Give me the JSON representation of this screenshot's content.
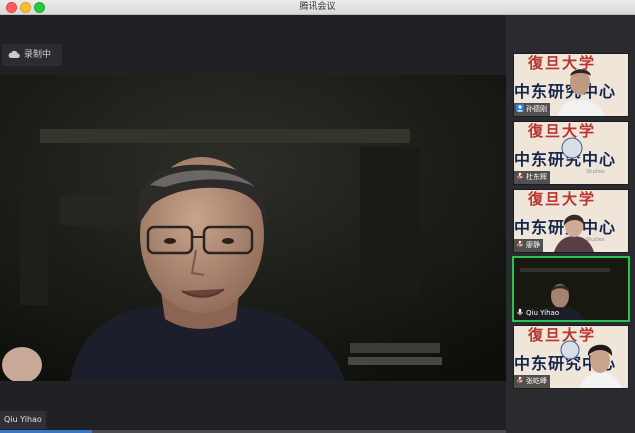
{
  "window": {
    "title": "腾讯会议"
  },
  "recording": {
    "label": "录制中"
  },
  "main_speaker": {
    "name": "Qiu Yihao"
  },
  "participants": [
    {
      "name": "孙德刚",
      "icon": "user-icon",
      "banner_top": "復旦大学",
      "banner_mid": "中东研究中心"
    },
    {
      "name": "杜东辉",
      "icon": "mic-off-icon",
      "banner_top": "復旦大学",
      "banner_mid": "中东研究中心",
      "banner_sub": "Studies"
    },
    {
      "name": "廖静",
      "icon": "mic-off-icon",
      "banner_top": "復旦大学",
      "banner_mid": "中东研究中心",
      "banner_sub": "Studies"
    },
    {
      "name": "Qiu Yihao",
      "icon": "mic-icon"
    },
    {
      "name": "张屹峰",
      "icon": "mic-off-icon",
      "banner_top": "復旦大学",
      "banner_mid": "中东研究中心"
    }
  ]
}
